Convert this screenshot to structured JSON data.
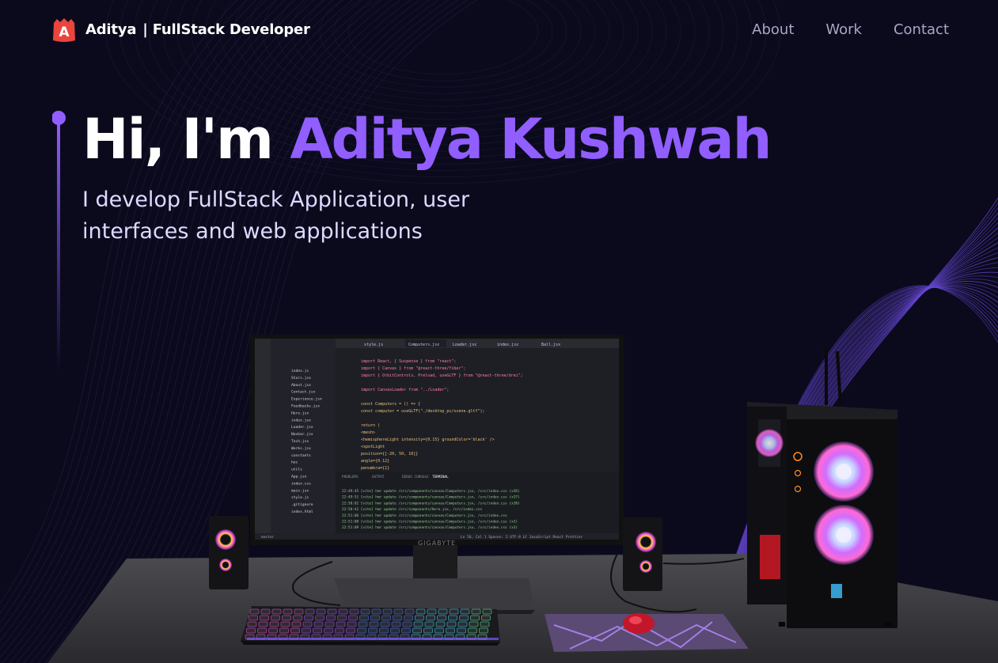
{
  "nav": {
    "logo_letter": "A",
    "brand_name": "Aditya",
    "brand_role": "| FullStack Developer",
    "links": [
      {
        "label": "About"
      },
      {
        "label": "Work"
      },
      {
        "label": "Contact"
      }
    ]
  },
  "hero": {
    "greeting": "Hi, I'm",
    "name": "Aditya Kushwah",
    "subtitle": "I develop FullStack Application, user interfaces and web applications"
  },
  "scene": {
    "monitor_brand": "GIGABYTE",
    "editor": {
      "tabs": [
        "style.js",
        "Computers.jsx",
        "Loader.jsx",
        "index.jsx",
        "Ball.jsx"
      ],
      "files": [
        "index.js",
        "Stars.jsx",
        "About.jsx",
        "Contact.jsx",
        "Experience.jsx",
        "Feedbacks.jsx",
        "Hero.jsx",
        "index.jsx",
        "Loader.jsx",
        "Navbar.jsx",
        "Tech.jsx",
        "Works.jsx",
        "constants",
        "hoc",
        "utils",
        "App.jsx",
        "index.css",
        "main.jsx",
        "style.js",
        ".gitignore",
        "index.html"
      ],
      "code_lines": [
        "import React, { Suspense } from \"react\";",
        "import { Canvas } from \"@react-three/fiber\";",
        "import { OrbitControls, Preload, useGLTF } from \"@react-three/drei\";",
        "",
        "import CanvasLoader from \"../Loader\";",
        "",
        "const Computers = () => {",
        "  const computer = useGLTF(\"./desktop_pc/scene.gltf\");",
        "",
        "  return (",
        "    <mesh>",
        "      <hemisphereLight intensity={0.15} groundColor='black' />",
        "      <spotLight",
        "        position={[-20, 50, 10]}",
        "        angle={0.12}",
        "        penumbra={1}"
      ],
      "panel_tabs": [
        "PROBLEMS",
        "OUTPUT",
        "DEBUG CONSOLE",
        "TERMINAL"
      ],
      "terminal_lines": [
        "22:49:45 [vite] hmr update /src/components/canvas/Computers.jsx, /src/index.css (x36)",
        "22:49:51 [vite] hmr update /src/components/canvas/Computers.jsx, /src/index.css (x37)",
        "22:50:02 [vite] hmr update /src/components/canvas/Computers.jsx, /src/index.css (x38)",
        "22:50:42 [vite] hmr update /src/components/Hero.jsx, /src/index.css",
        "22:51:06 [vite] hmr update /src/components/canvas/Computers.jsx, /src/index.css",
        "22:51:08 [vite] hmr update /src/components/canvas/Computers.jsx, /src/index.css (x2)",
        "22:51:09 [vite] hmr update /src/components/canvas/Computers.jsx, /src/index.css (x3)"
      ],
      "status_left": "master",
      "status_right": "Ln 56, Col 1   Spaces: 2   UTF-8   LF   JavaScript React   Prettier"
    }
  },
  "colors": {
    "background": "#0b0a1d",
    "accent": "#915eff",
    "nav_link": "#aaa6c3",
    "logo": "#e9453d"
  }
}
